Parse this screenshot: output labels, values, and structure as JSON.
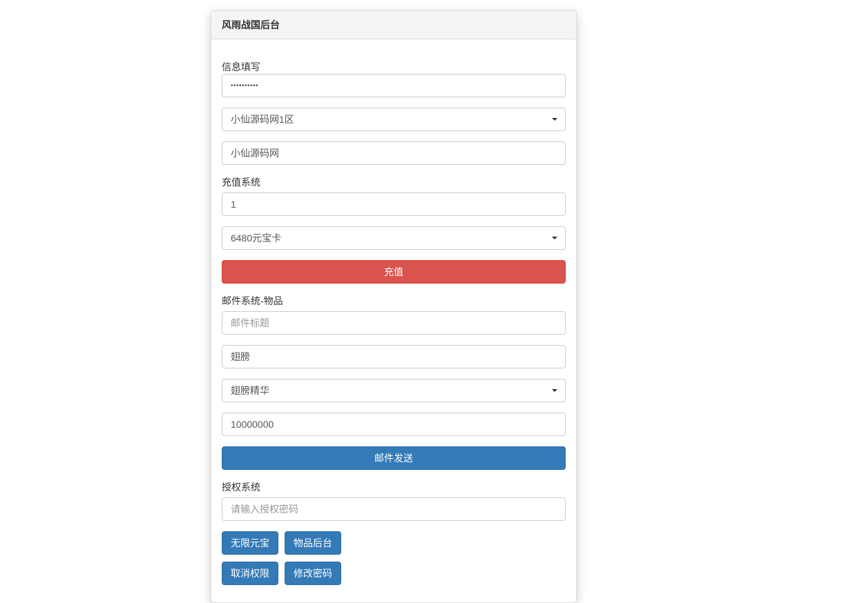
{
  "panel": {
    "title": "风雨战国后台"
  },
  "section_info": {
    "label": "信息填写",
    "password_value": "••••••••••",
    "server_select": "小仙源码网1区",
    "username_value": "小仙源码网"
  },
  "section_recharge": {
    "label": "充值系统",
    "quantity_value": "1",
    "card_select": "6480元宝卡",
    "submit_label": "充值"
  },
  "section_mail": {
    "label": "邮件系统-物品",
    "title_placeholder": "邮件标题",
    "name_value": "翅膀",
    "item_select": "翅膀精华",
    "amount_value": "10000000",
    "submit_label": "邮件发送"
  },
  "section_auth": {
    "label": "授权系统",
    "password_placeholder": "请输入授权密码"
  },
  "buttons": {
    "unlimited_gold": "无限元宝",
    "item_admin": "物品后台",
    "cancel_auth": "取消权限",
    "change_password": "修改密码"
  }
}
